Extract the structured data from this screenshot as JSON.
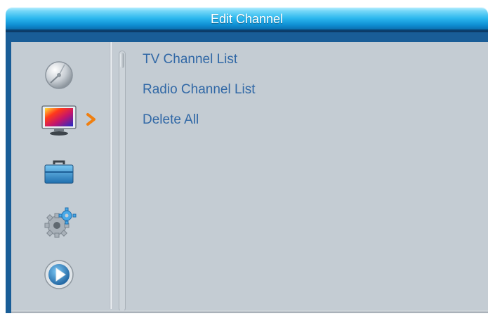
{
  "header": {
    "title": "Edit Channel"
  },
  "sidebar": {
    "items": [
      {
        "name": "installation",
        "icon": "satellite-dish-icon"
      },
      {
        "name": "channel",
        "icon": "tv-icon",
        "selected": true
      },
      {
        "name": "tools",
        "icon": "toolbox-icon"
      },
      {
        "name": "settings",
        "icon": "gear-icon"
      },
      {
        "name": "media",
        "icon": "play-icon"
      }
    ],
    "selection_arrow": "chevron-right-icon"
  },
  "menu": {
    "items": [
      {
        "label": "TV Channel List"
      },
      {
        "label": "Radio Channel List"
      },
      {
        "label": "Delete All"
      }
    ]
  },
  "colors": {
    "title_bar": "#1fa7e6",
    "frame": "#195d97",
    "background": "#c4ccd3",
    "menu_text": "#3168a6",
    "selection_arrow": "#f07f10"
  }
}
